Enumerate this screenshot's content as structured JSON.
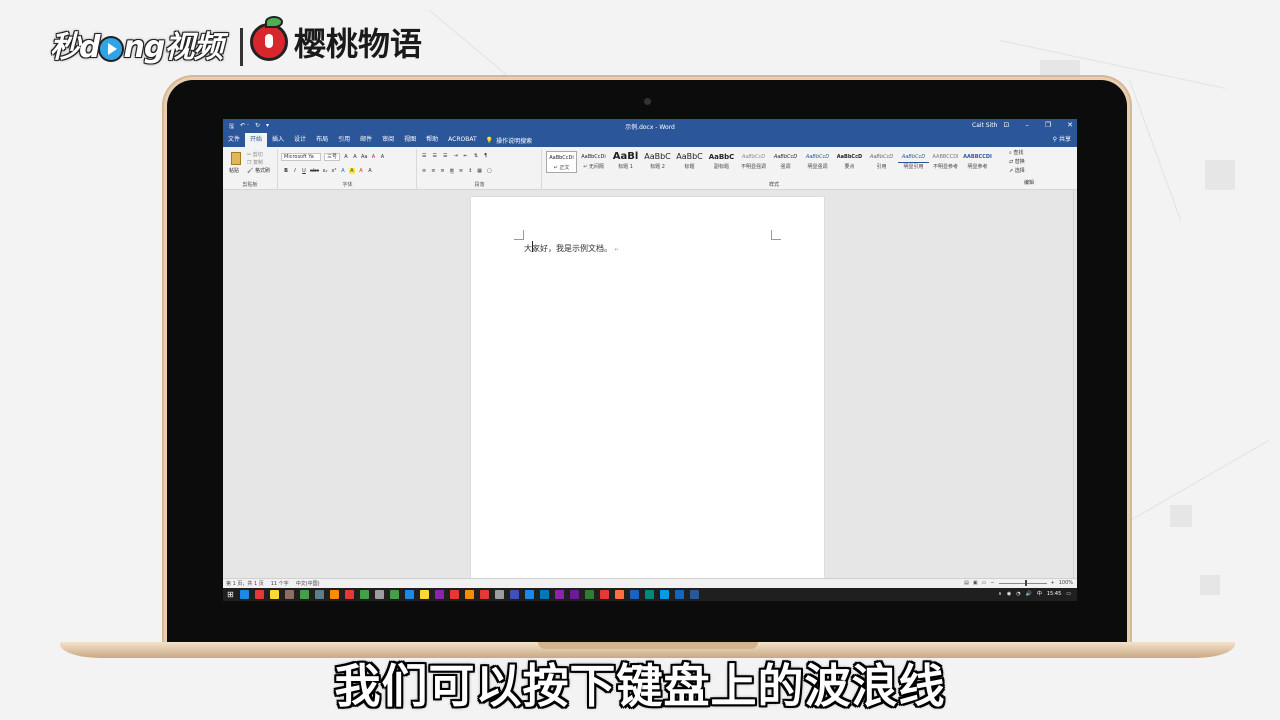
{
  "branding": {
    "miaodong_logo_pre": "秒d",
    "miaodong_logo_post": "ng视频",
    "cherry_logo": "樱桃物语"
  },
  "word": {
    "window_title": "示例.docx - Word",
    "user_name": "Cait Sith",
    "qat": [
      "🖫",
      "↶ ·",
      "↻",
      "▾"
    ],
    "window_buttons": [
      "⊡",
      "–",
      "❐",
      "✕"
    ],
    "tabs": [
      "文件",
      "开始",
      "插入",
      "设计",
      "布局",
      "引用",
      "邮件",
      "审阅",
      "视图",
      "帮助",
      "ACROBAT"
    ],
    "active_tab": "开始",
    "tell_me": "操作说明搜索",
    "share": "共享",
    "ribbon": {
      "clipboard": {
        "paste": "粘贴",
        "cut": "剪切",
        "copy": "复制",
        "format_painter": "格式刷",
        "label": "剪贴板"
      },
      "font": {
        "name": "Microsoft Ya",
        "size": "三号",
        "label": "字体",
        "row1_buttons": [
          "A",
          "A",
          "Aa",
          "A",
          "A"
        ],
        "row2_buttons": [
          "B",
          "I",
          "U",
          "abc",
          "x₂",
          "x²",
          "A",
          "A",
          "A",
          "A"
        ]
      },
      "paragraph": {
        "label": "段落",
        "row1_buttons": [
          "☰",
          "☰",
          "☰",
          "⇥",
          "⇤",
          "⇅",
          "¶"
        ],
        "row2_buttons": [
          "≡",
          "≡",
          "≡",
          "≡",
          "≡",
          "↕",
          "▦",
          "▢"
        ]
      },
      "styles": {
        "label": "样式",
        "items": [
          {
            "sample": "AaBbCcDi",
            "name": "↵ 正文"
          },
          {
            "sample": "AaBbCcDi",
            "name": "↵ 无间隔"
          },
          {
            "sample": "AaBl",
            "name": "标题 1"
          },
          {
            "sample": "AaBbC",
            "name": "标题 2"
          },
          {
            "sample": "AaBbC",
            "name": "标题"
          },
          {
            "sample": "AaBbC",
            "name": "副标题"
          },
          {
            "sample": "AaBbCcD",
            "name": "不明显强调"
          },
          {
            "sample": "AaBbCcD",
            "name": "强调"
          },
          {
            "sample": "AaBbCcD",
            "name": "明显强调"
          },
          {
            "sample": "AaBbCcD",
            "name": "要点"
          },
          {
            "sample": "AaBbCcD",
            "name": "引用"
          },
          {
            "sample": "AaBbCcD",
            "name": "明显引用"
          },
          {
            "sample": "AABBCCDI",
            "name": "不明显参考"
          },
          {
            "sample": "AABBCCDI",
            "name": "明显参考"
          }
        ]
      },
      "editing": {
        "find": "查找",
        "replace": "替换",
        "select": "选择",
        "label": "编辑"
      }
    },
    "document": {
      "text": "大家好，我是示例文档。",
      "pilcrow": "↵"
    },
    "status": {
      "page": "第 1 页，共 1 页",
      "words": "11 个字",
      "language": "中文(中国)",
      "zoom": "100%"
    },
    "tray": {
      "time": "15:45",
      "items": [
        "∧",
        "◉",
        "◔",
        "🔊",
        "中"
      ]
    }
  },
  "subtitle": "我们可以按下键盘上的波浪线",
  "colors": {
    "word_blue": "#2b579a",
    "taskbar": "#1f1f1f",
    "laptop_gold": "#e8cfb2"
  },
  "taskbar_icon_colors": [
    "#1e88e5",
    "#e53935",
    "#fdd835",
    "#8d6e63",
    "#43a047",
    "#607d8b",
    "#fb8c00",
    "#e53935",
    "#43a047",
    "#9e9e9e",
    "#43a047",
    "#1e88e5",
    "#fdd835",
    "#8e24aa",
    "#e53935",
    "#fb8c00",
    "#e53935",
    "#9e9e9e",
    "#3f51b5",
    "#1e88e5",
    "#0277bd",
    "#8e24aa",
    "#6a1b9a",
    "#2e7d32",
    "#e53935",
    "#ff7043",
    "#1565c0",
    "#00897b",
    "#039be5",
    "#1565c0",
    "#2b579a"
  ]
}
